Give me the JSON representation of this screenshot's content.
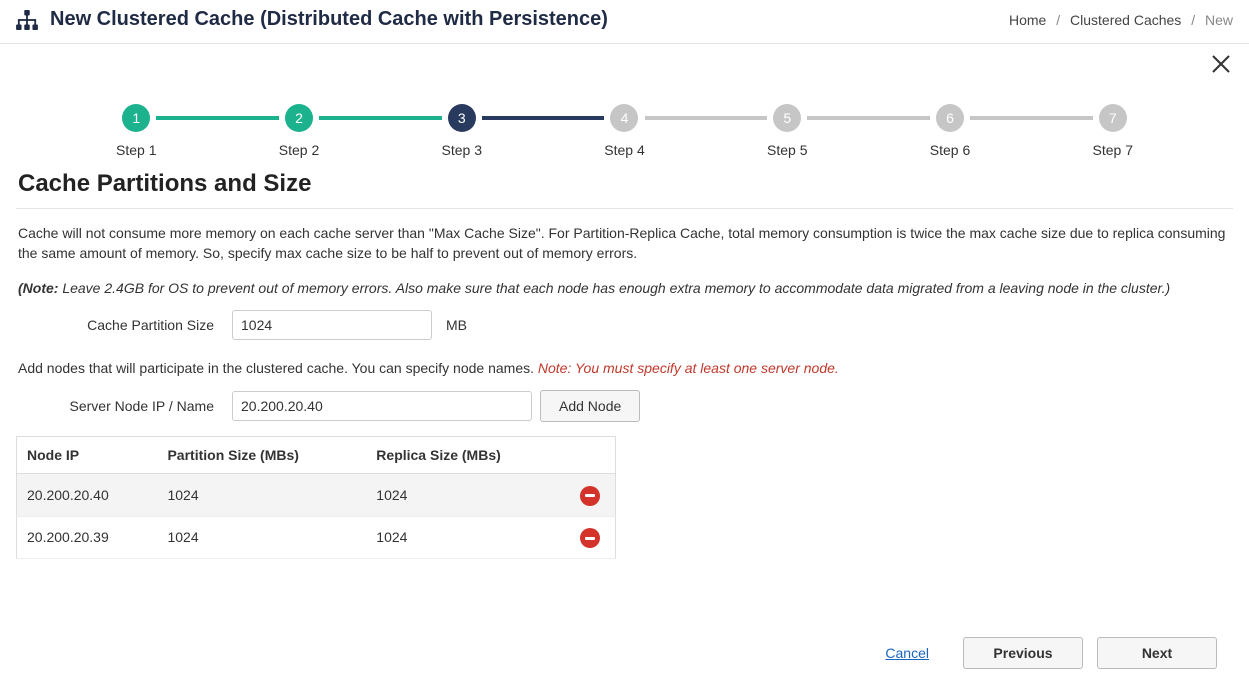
{
  "header": {
    "title": "New Clustered Cache (Distributed Cache with Persistence)"
  },
  "breadcrumb": {
    "home": "Home",
    "caches": "Clustered Caches",
    "current": "New"
  },
  "stepper": {
    "steps": [
      {
        "num": "1",
        "label": "Step 1",
        "state": "done"
      },
      {
        "num": "2",
        "label": "Step 2",
        "state": "done"
      },
      {
        "num": "3",
        "label": "Step 3",
        "state": "active"
      },
      {
        "num": "4",
        "label": "Step 4",
        "state": "future"
      },
      {
        "num": "5",
        "label": "Step 5",
        "state": "future"
      },
      {
        "num": "6",
        "label": "Step 6",
        "state": "future"
      },
      {
        "num": "7",
        "label": "Step 7",
        "state": "future"
      }
    ]
  },
  "section": {
    "title": "Cache Partitions and Size",
    "desc": "Cache will not consume more memory on each cache server than \"Max Cache Size\". For Partition-Replica Cache, total memory consumption is twice the max cache size due to replica consuming the same amount of memory. So, specify max cache size to be half to prevent out of memory errors.",
    "note_prefix": "(Note:",
    "note_body": " Leave 2.4GB for OS to prevent out of memory errors. Also make sure that each node has enough extra memory to accommodate data migrated from a leaving node in the cluster.)",
    "partition_label": "Cache Partition Size",
    "partition_value": "1024",
    "partition_unit": "MB",
    "add_nodes_text": "Add nodes that will participate in the clustered cache. You can specify node names. ",
    "add_nodes_warn": "Note: You must specify at least one server node.",
    "server_label": "Server Node IP / Name",
    "server_value": "20.200.20.40",
    "add_node_btn": "Add Node"
  },
  "table": {
    "headers": {
      "ip": "Node IP",
      "partition": "Partition Size (MBs)",
      "replica": "Replica Size (MBs)"
    },
    "rows": [
      {
        "ip": "20.200.20.40",
        "partition": "1024",
        "replica": "1024"
      },
      {
        "ip": "20.200.20.39",
        "partition": "1024",
        "replica": "1024"
      }
    ]
  },
  "footer": {
    "cancel": "Cancel",
    "previous": "Previous",
    "next": "Next"
  }
}
